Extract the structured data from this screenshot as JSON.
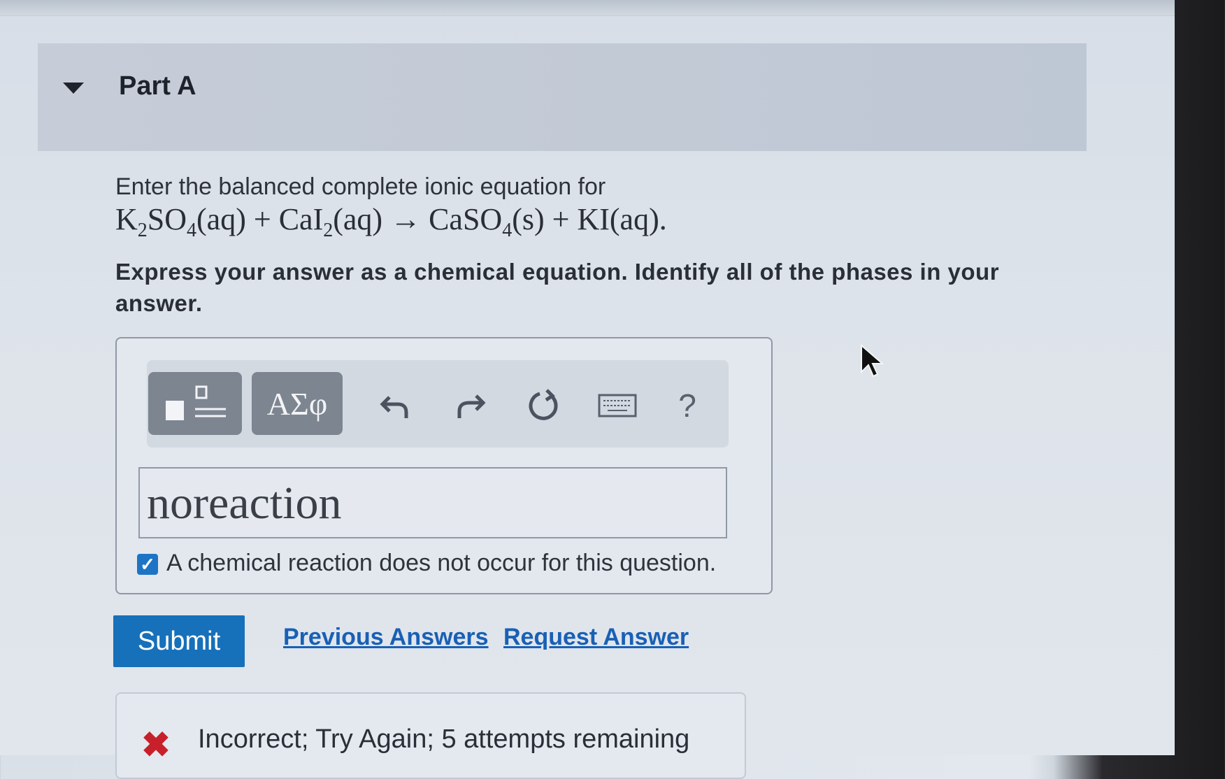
{
  "part": {
    "title": "Part A"
  },
  "question": {
    "prompt": "Enter the balanced complete ionic equation for",
    "equation": {
      "r1": "K",
      "r1_sub1": "2",
      "r1_b": "SO",
      "r1_sub2": "4",
      "r1_phase": "(aq)",
      "plus1": "+",
      "r2": "CaI",
      "r2_sub": "2",
      "r2_phase": "(aq)",
      "arrow": "→",
      "p1": "CaSO",
      "p1_sub": "4",
      "p1_phase": "(s)",
      "plus2": "+",
      "p2": "KI(aq)."
    },
    "instruction": "Express your answer as a chemical equation. Identify all of the phases in your answer."
  },
  "toolbar": {
    "greek_label": "ΑΣφ",
    "help_label": "?"
  },
  "answer": {
    "value": "noreaction",
    "no_reaction_label": "A chemical reaction does not occur for this question.",
    "no_reaction_checked": true
  },
  "actions": {
    "submit_label": "Submit",
    "previous_answers_label": "Previous Answers",
    "request_answer_label": "Request Answer"
  },
  "feedback": {
    "text": "Incorrect; Try Again; 5 attempts remaining",
    "status_color": "#c8202b"
  },
  "colors": {
    "accent": "#1670ba",
    "link": "#1960b5"
  }
}
